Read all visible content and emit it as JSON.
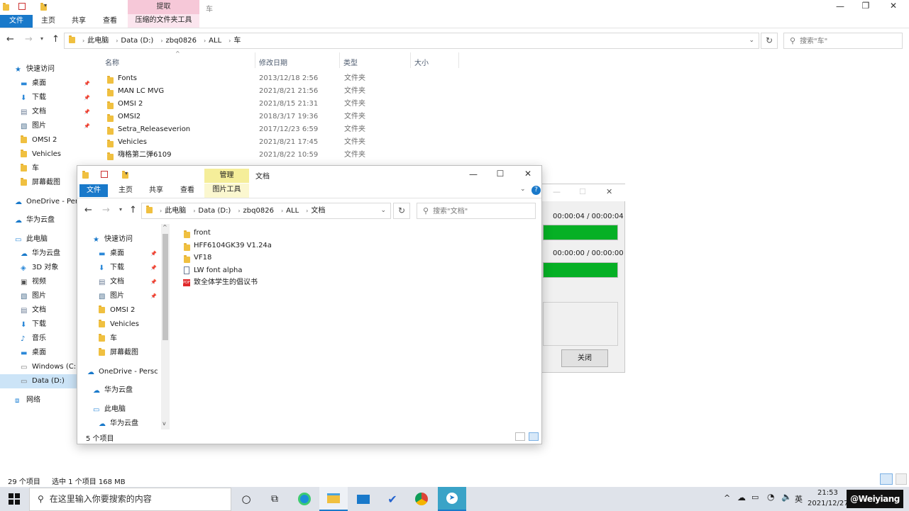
{
  "main_window": {
    "title": "车",
    "ribbon_context_tab": "提取",
    "ribbon_context_tools": "压缩的文件夹工具",
    "tabs": [
      "文件",
      "主页",
      "共享",
      "查看"
    ],
    "breadcrumb": [
      "此电脑",
      "Data (D:)",
      "zbq0826",
      "ALL",
      "车"
    ],
    "search_placeholder": "搜索\"车\"",
    "columns": [
      "名称",
      "修改日期",
      "类型",
      "大小"
    ],
    "files": [
      {
        "name": "Fonts",
        "date": "2013/12/18 2:56",
        "type": "文件夹"
      },
      {
        "name": "MAN LC MVG",
        "date": "2021/8/21 21:56",
        "type": "文件夹"
      },
      {
        "name": "OMSI 2",
        "date": "2021/8/15 21:31",
        "type": "文件夹"
      },
      {
        "name": "OMSI2",
        "date": "2018/3/17 19:36",
        "type": "文件夹"
      },
      {
        "name": "Setra_Releaseverion",
        "date": "2017/12/23 6:59",
        "type": "文件夹"
      },
      {
        "name": "Vehicles",
        "date": "2021/8/21 17:45",
        "type": "文件夹"
      },
      {
        "name": "嗨格第二弹6109",
        "date": "2021/8/22 10:59",
        "type": "文件夹"
      }
    ],
    "nav": [
      {
        "label": "快速访问",
        "icon": "star-icon",
        "pin": false
      },
      {
        "label": "桌面",
        "icon": "desktop-icon",
        "pin": true
      },
      {
        "label": "下载",
        "icon": "download-icon",
        "pin": true
      },
      {
        "label": "文档",
        "icon": "document-icon",
        "pin": true
      },
      {
        "label": "图片",
        "icon": "pictures-icon",
        "pin": true
      },
      {
        "label": "OMSI 2",
        "icon": "folder-icon",
        "pin": false
      },
      {
        "label": "Vehicles",
        "icon": "folder-icon",
        "pin": false
      },
      {
        "label": "车",
        "icon": "folder-icon",
        "pin": false
      },
      {
        "label": "屏幕截图",
        "icon": "folder-icon",
        "pin": false
      },
      {
        "label": "OneDrive - Per",
        "icon": "cloud-icon",
        "pin": false
      },
      {
        "label": "华为云盘",
        "icon": "cloud-icon",
        "pin": false
      },
      {
        "label": "此电脑",
        "icon": "computer-icon",
        "pin": false
      },
      {
        "label": "华为云盘",
        "icon": "cloud-icon",
        "pin": false
      },
      {
        "label": "3D 对象",
        "icon": "cube-icon",
        "pin": false
      },
      {
        "label": "视频",
        "icon": "video-icon",
        "pin": false
      },
      {
        "label": "图片",
        "icon": "pictures-icon",
        "pin": false
      },
      {
        "label": "文档",
        "icon": "document-icon",
        "pin": false
      },
      {
        "label": "下载",
        "icon": "download-icon",
        "pin": false
      },
      {
        "label": "音乐",
        "icon": "music-icon",
        "pin": false
      },
      {
        "label": "桌面",
        "icon": "desktop-icon",
        "pin": false
      },
      {
        "label": "Windows (C:)",
        "icon": "drive-icon",
        "pin": false
      },
      {
        "label": "Data (D:)",
        "icon": "drive-icon",
        "pin": false
      },
      {
        "label": "网络",
        "icon": "network-icon",
        "pin": false
      }
    ],
    "status_count": "29 个项目",
    "status_selected": "选中 1 个项目 168 MB"
  },
  "doc_window": {
    "title": "文档",
    "ribbon_context_tab": "管理",
    "ribbon_context_tools": "图片工具",
    "tabs": [
      "文件",
      "主页",
      "共享",
      "查看"
    ],
    "breadcrumb": [
      "此电脑",
      "Data (D:)",
      "zbq0826",
      "ALL",
      "文档"
    ],
    "search_placeholder": "搜索\"文档\"",
    "files": [
      {
        "name": "front",
        "kind": "folder"
      },
      {
        "name": "HFF6104GK39 V1.24a",
        "kind": "folder"
      },
      {
        "name": "VF18",
        "kind": "folder"
      },
      {
        "name": "LW  font  alpha",
        "kind": "text"
      },
      {
        "name": "致全体学生的倡议书",
        "kind": "pdf"
      }
    ],
    "nav": [
      {
        "label": "快速访问",
        "icon": "star-icon",
        "pin": false
      },
      {
        "label": "桌面",
        "icon": "desktop-icon",
        "pin": true
      },
      {
        "label": "下载",
        "icon": "download-icon",
        "pin": true
      },
      {
        "label": "文档",
        "icon": "document-icon",
        "pin": true
      },
      {
        "label": "图片",
        "icon": "pictures-icon",
        "pin": true
      },
      {
        "label": "OMSI 2",
        "icon": "folder-icon",
        "pin": false
      },
      {
        "label": "Vehicles",
        "icon": "folder-icon",
        "pin": false
      },
      {
        "label": "车",
        "icon": "folder-icon",
        "pin": false
      },
      {
        "label": "屏幕截图",
        "icon": "folder-icon",
        "pin": false
      },
      {
        "label": "OneDrive - Persc",
        "icon": "cloud-icon",
        "pin": false
      },
      {
        "label": "华为云盘",
        "icon": "cloud-icon",
        "pin": false
      },
      {
        "label": "此电脑",
        "icon": "computer-icon",
        "pin": false
      },
      {
        "label": "华为云盘",
        "icon": "cloud-icon",
        "pin": false
      }
    ],
    "status_count": "5 个项目"
  },
  "progress_dialog": {
    "time1": "00:00:04 / 00:00:04",
    "time2": "00:00:00 / 00:00:00",
    "progress1": 1.0,
    "progress2": 1.0,
    "close_label": "关闭"
  },
  "taskbar": {
    "search_placeholder": "在这里输入你要搜索的内容",
    "time": "21:53",
    "date": "2021/12/27",
    "ime": "英",
    "watermark": "@Weiyiang"
  },
  "colors": {
    "accent": "#1979ca",
    "progress": "#06b025",
    "zip_tab": "#f6c8d8",
    "manage_tab": "#f5ee9a",
    "taskbar": "#dfe3ea"
  }
}
